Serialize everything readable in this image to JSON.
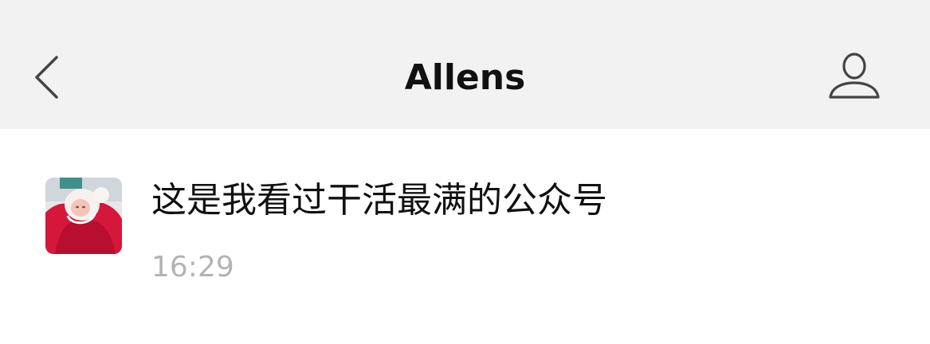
{
  "header": {
    "title": "Allens",
    "back_icon": "chevron-left-icon",
    "profile_icon": "user-profile-icon"
  },
  "message": {
    "text": "这是我看过干活最满的公众号",
    "time": "16:29",
    "avatar_icon": "baby-in-red-jacket-avatar"
  },
  "colors": {
    "nav_background": "#f2f2f2",
    "text_primary": "#111111",
    "text_secondary": "#b3b3b3",
    "icon_stroke": "#444444"
  }
}
